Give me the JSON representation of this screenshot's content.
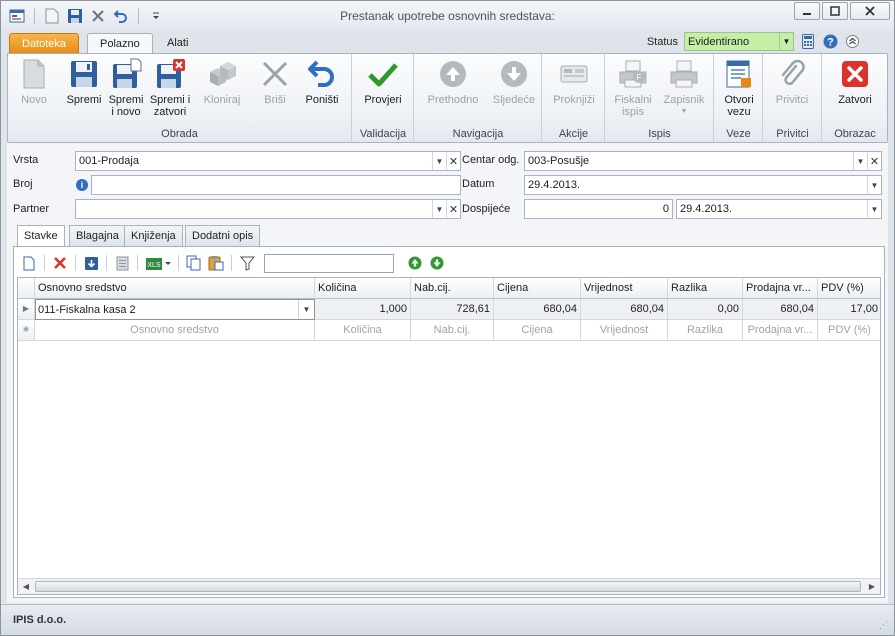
{
  "window": {
    "title": "Prestanak upotrebe osnovnih sredstava:"
  },
  "ribbon_tabs": [
    "Datoteka",
    "Polazno",
    "Alati"
  ],
  "status": {
    "label": "Status",
    "value": "Evidentirano"
  },
  "ribbon": {
    "groups": {
      "obrada": "Obrada",
      "validacija": "Validacija",
      "navigacija": "Navigacija",
      "akcije": "Akcije",
      "ispis": "Ispis",
      "veze": "Veze",
      "privitci": "Privitci",
      "obrazac": "Obrazac"
    },
    "buttons": {
      "novo": "Novo",
      "spremi": "Spremi",
      "spremi_novo_1": "Spremi",
      "spremi_novo_2": "i novo",
      "spremi_zatvori_1": "Spremi i",
      "spremi_zatvori_2": "zatvori",
      "kloniraj": "Kloniraj",
      "brisi": "Briši",
      "ponisti": "Poništi",
      "provjeri": "Provjeri",
      "prethodno": "Prethodno",
      "sljedece": "Sljedeće",
      "proknjizi": "Proknjiži",
      "fiskalni_1": "Fiskalni",
      "fiskalni_2": "ispis",
      "zapisnik": "Zapisnik",
      "otvori_1": "Otvori",
      "otvori_2": "vezu",
      "privitci": "Privitci",
      "zatvori": "Zatvori"
    }
  },
  "form": {
    "vrsta": {
      "label": "Vrsta",
      "value": "001-Prodaja"
    },
    "broj": {
      "label": "Broj",
      "value": ""
    },
    "partner": {
      "label": "Partner",
      "value": ""
    },
    "centar": {
      "label": "Centar odg.",
      "value": "003-Posušje"
    },
    "datum": {
      "label": "Datum",
      "value": "29.4.2013."
    },
    "dospijece": {
      "label": "Dospijeće",
      "days": "0",
      "date": "29.4.2013."
    }
  },
  "subtabs": [
    "Stavke",
    "Blagajna",
    "Knjiženja",
    "Dodatni opis"
  ],
  "grid": {
    "columns": [
      "Osnovno sredstvo",
      "Količina",
      "Nab.cij.",
      "Cijena",
      "Vrijednost",
      "Razlika",
      "Prodajna vr...",
      "PDV (%)"
    ],
    "rows": [
      [
        "011-Fiskalna kasa 2",
        "1,000",
        "728,61",
        "680,04",
        "680,04",
        "0,00",
        "680,04",
        "17,00"
      ]
    ],
    "new_row_placeholders": [
      "Osnovno sredstvo",
      "Količina",
      "Nab.cij.",
      "Cijena",
      "Vrijednost",
      "Razlika",
      "Prodajna vr...",
      "PDV (%)"
    ]
  },
  "statusbar": {
    "company": "IPIS d.o.o."
  },
  "colors": {
    "accent_orange": "#e98a10",
    "status_green": "#c3f0a6",
    "close_red": "#d9332b",
    "check_green": "#2e9a2e",
    "blue_icon": "#2f6fc0"
  }
}
